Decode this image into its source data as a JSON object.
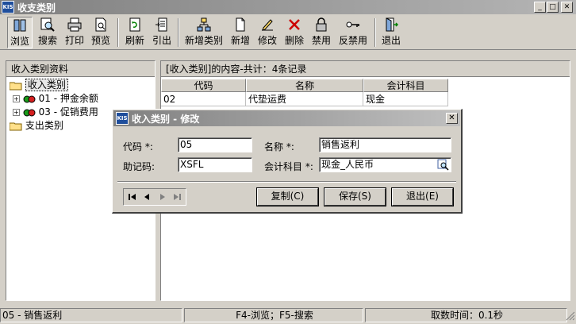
{
  "window": {
    "logo_text": "KIS",
    "title": "收支类别",
    "min_glyph": "_",
    "max_glyph": "□",
    "close_glyph": "✕"
  },
  "toolbar": {
    "items": [
      {
        "label": "浏览",
        "icon": "browse-icon"
      },
      {
        "label": "搜索",
        "icon": "search-icon"
      },
      {
        "label": "打印",
        "icon": "printer-icon"
      },
      {
        "label": "预览",
        "icon": "preview-icon"
      },
      {
        "label": "刷新",
        "icon": "refresh-icon"
      },
      {
        "label": "引出",
        "icon": "export-icon"
      },
      {
        "label": "新增类别",
        "icon": "new-category-icon"
      },
      {
        "label": "新增",
        "icon": "new-icon"
      },
      {
        "label": "修改",
        "icon": "edit-icon"
      },
      {
        "label": "删除",
        "icon": "delete-icon"
      },
      {
        "label": "禁用",
        "icon": "lock-icon"
      },
      {
        "label": "反禁用",
        "icon": "key-icon"
      },
      {
        "label": "退出",
        "icon": "exit-icon"
      }
    ]
  },
  "left_panel": {
    "header": "收入类别资料",
    "tree": {
      "root_income": "收入类别",
      "children": [
        "01 - 押金余额",
        "03 - 促销费用"
      ],
      "root_expense": "支出类别"
    }
  },
  "right_panel": {
    "header": "[收入类别]的内容-共计：4条记录",
    "columns": [
      "代码",
      "名称",
      "会计科目"
    ],
    "rows": [
      [
        "02",
        "代垫运费",
        "现金"
      ]
    ]
  },
  "dialog": {
    "logo_text": "KIS",
    "title": "收入类别 - 修改",
    "close_glyph": "✕",
    "fields": {
      "code_label": "代码 *:",
      "code_value": "05",
      "name_label": "名称 *:",
      "name_value": "销售返利",
      "mnemonic_label": "助记码:",
      "mnemonic_value": "XSFL",
      "account_label": "会计科目 *:",
      "account_value": "现金_人民币"
    },
    "buttons": {
      "copy": "复制(C)",
      "save": "保存(S)",
      "exit": "退出(E)"
    }
  },
  "statusbar": {
    "current": "05 - 销售返利",
    "hints": "F4-浏览；F5-搜索",
    "fetch_time": "取数时间：0.1秒"
  },
  "colors": {
    "face": "#d4d0c8",
    "title_start": "#808080",
    "title_end": "#b5b5b5",
    "logo_blue": "#1f4e9c",
    "delete_red": "#cc0000"
  }
}
